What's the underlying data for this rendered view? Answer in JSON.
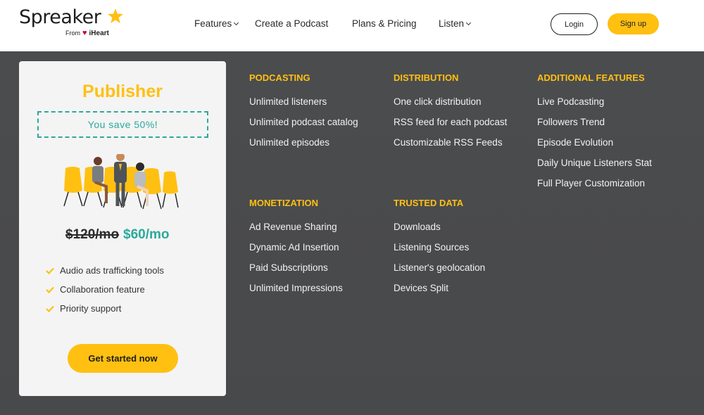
{
  "header": {
    "logo_text": "Spreaker",
    "logo_from": "From",
    "logo_brand": "iHeart",
    "nav": [
      {
        "label": "Features",
        "dropdown": true
      },
      {
        "label": "Create a Podcast",
        "dropdown": false
      },
      {
        "label": "Plans & Pricing",
        "dropdown": false
      },
      {
        "label": "Listen",
        "dropdown": true
      }
    ],
    "login_label": "Login",
    "signup_label": "Sign up"
  },
  "plan": {
    "title": "Publisher",
    "savings": "You save 50%!",
    "price_old": "$120/mo",
    "price_new": "$60/mo",
    "benefits": [
      "Audio ads trafficking tools",
      "Collaboration feature",
      "Priority support"
    ],
    "cta_label": "Get started now"
  },
  "features": {
    "podcasting": {
      "title": "PODCASTING",
      "items": [
        "Unlimited listeners",
        "Unlimited podcast catalog",
        "Unlimited episodes"
      ]
    },
    "distribution": {
      "title": "DISTRIBUTION",
      "items": [
        "One click distribution",
        "RSS feed for each podcast",
        "Customizable RSS Feeds"
      ]
    },
    "additional": {
      "title": "ADDITIONAL FEATURES",
      "items": [
        "Live Podcasting",
        "Followers Trend",
        "Episode Evolution",
        "Daily Unique Listeners Stat",
        "Full Player Customization"
      ]
    },
    "monetization": {
      "title": "MONETIZATION",
      "items": [
        "Ad Revenue Sharing",
        "Dynamic Ad Insertion",
        "Paid Subscriptions",
        "Unlimited Impressions"
      ]
    },
    "trusted_data": {
      "title": "TRUSTED DATA",
      "items": [
        "Downloads",
        "Listening Sources",
        "Listener's geolocation",
        "Devices Split"
      ]
    }
  },
  "colors": {
    "accent": "#ffc012",
    "teal": "#2ba99b",
    "overlay": "#4a4b4d"
  },
  "icons": {
    "logo_star": "star-icon",
    "check": "check-icon",
    "heart": "iheart-heart-icon"
  }
}
